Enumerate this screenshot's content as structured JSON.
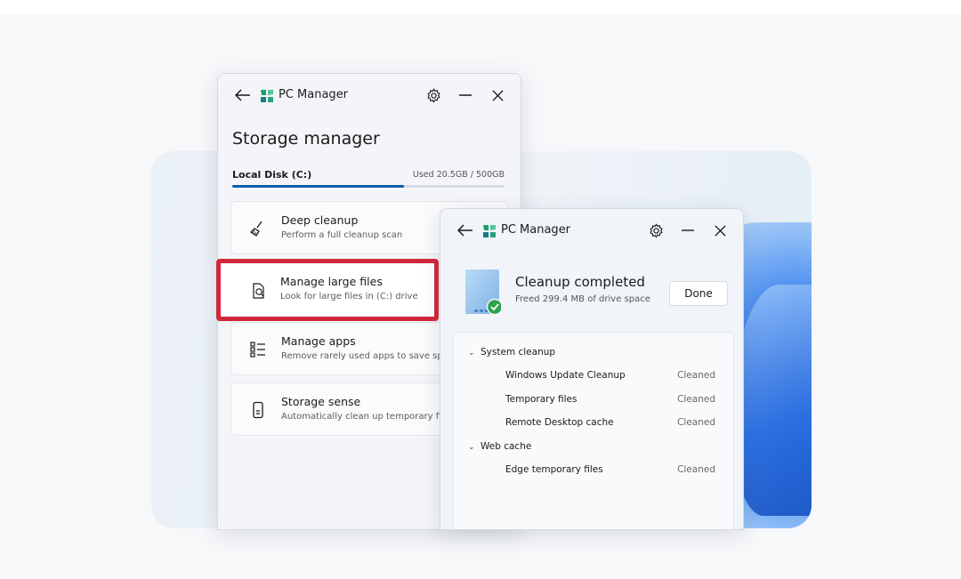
{
  "storage_window": {
    "app_name": "PC Manager",
    "heading": "Storage manager",
    "disk": {
      "label": "Local Disk (C:)",
      "usage_text": "Used 20.5GB / 500GB",
      "usage_fraction": 0.63
    },
    "cards": [
      {
        "title": "Deep cleanup",
        "subtitle": "Perform a full cleanup scan"
      },
      {
        "title": "Manage large files",
        "subtitle": "Look for large files in (C:) drive"
      },
      {
        "title": "Manage apps",
        "subtitle": "Remove rarely used apps to save space"
      },
      {
        "title": "Storage sense",
        "subtitle": "Automatically clean up temporary files"
      }
    ]
  },
  "cleanup_window": {
    "app_name": "PC Manager",
    "status_title": "Cleanup completed",
    "status_subtitle": "Freed 299.4 MB of drive space",
    "done_label": "Done",
    "groups": [
      {
        "name": "System cleanup",
        "items": [
          {
            "name": "Windows Update Cleanup",
            "status": "Cleaned"
          },
          {
            "name": "Temporary files",
            "status": "Cleaned"
          },
          {
            "name": "Remote Desktop cache",
            "status": "Cleaned"
          }
        ]
      },
      {
        "name": "Web cache",
        "items": [
          {
            "name": "Edge temporary files",
            "status": "Cleaned"
          }
        ]
      }
    ]
  },
  "colors": {
    "accent": "#0b5cad",
    "highlight": "#d0283a",
    "success": "#2ca34a"
  },
  "icons": [
    "back-arrow-icon",
    "pc-manager-logo-icon",
    "gear-icon",
    "minimize-icon",
    "close-icon",
    "broom-icon",
    "large-files-icon",
    "apps-list-icon",
    "phone-storage-icon",
    "drive-check-icon",
    "chevron-down-icon"
  ]
}
